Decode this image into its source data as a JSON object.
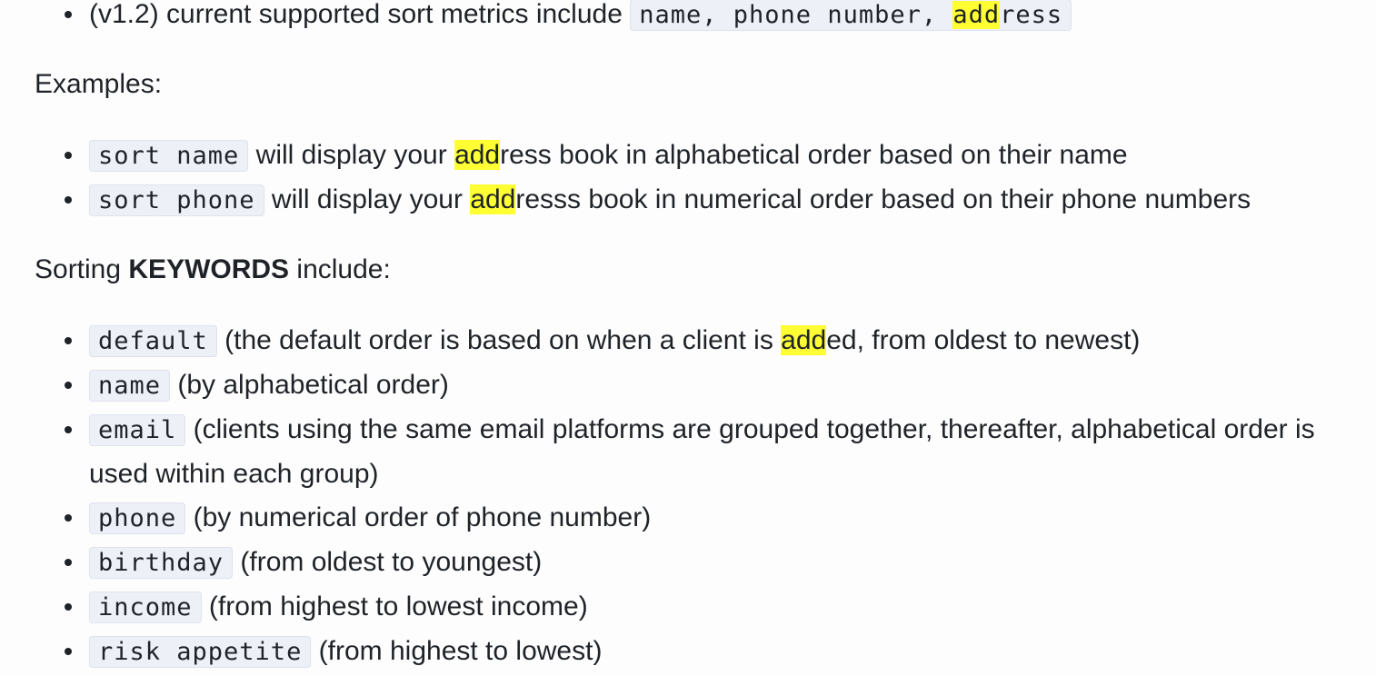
{
  "highlight": {
    "term": "add",
    "color": "#ffff33"
  },
  "colors": {
    "code_bg": "#eef0f8",
    "text": "#1f2328"
  },
  "intro": {
    "prefix": "(v1.2) current supported sort metrics include ",
    "code_pre": "name, phone number, ",
    "code_mark": "add",
    "code_post": "ress"
  },
  "examples": {
    "heading": "Examples:",
    "items": [
      {
        "code": "sort name",
        "pre": " will display your ",
        "mark": "add",
        "post": "ress book in alphabetical order based on their name"
      },
      {
        "code": "sort phone",
        "pre": " will display your ",
        "mark": "add",
        "post": "resss book in numerical order based on their phone numbers"
      }
    ]
  },
  "keywords": {
    "heading_pre": "Sorting ",
    "heading_bold": "KEYWORDS",
    "heading_post": " include:",
    "items": [
      {
        "code": "default",
        "pre": " (the default order is based on when a client is ",
        "mark": "add",
        "post": "ed, from oldest to newest)"
      },
      {
        "code": "name",
        "text": " (by alphabetical order)"
      },
      {
        "code": "email",
        "text": " (clients using the same email platforms are grouped together, thereafter, alphabetical order is used within each group)"
      },
      {
        "code": "phone",
        "text": " (by numerical order of phone number)"
      },
      {
        "code": "birthday",
        "text": " (from oldest to youngest)"
      },
      {
        "code": "income",
        "text": " (from highest to lowest income)"
      },
      {
        "code": "risk appetite",
        "text": " (from highest to lowest)"
      }
    ]
  }
}
